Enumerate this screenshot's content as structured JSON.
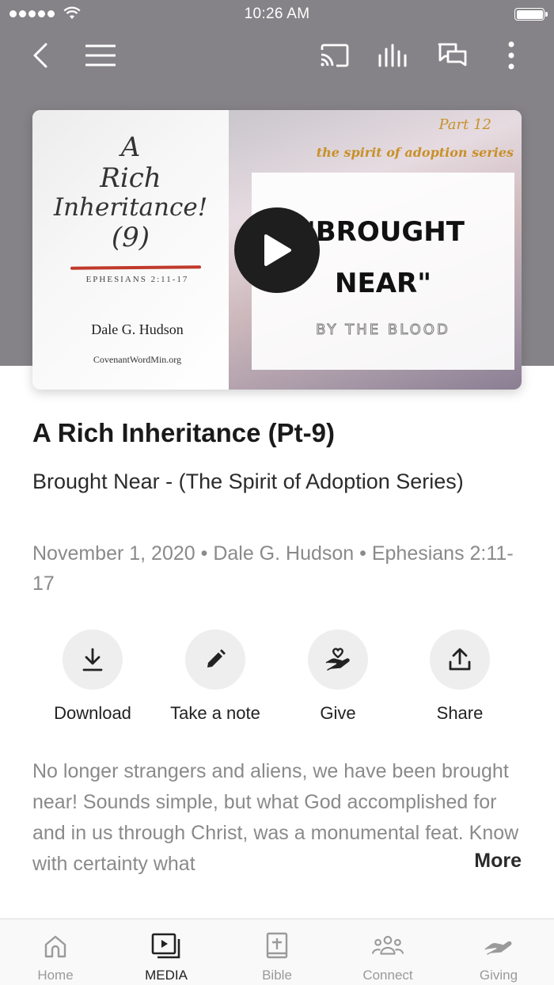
{
  "status_bar": {
    "time": "10:26 AM"
  },
  "hero": {
    "book": {
      "title_line1": "A",
      "title_line2": "Rich",
      "title_line3": "Inheritance!",
      "title_line4": "(9)",
      "reference": "EPHESIANS 2:11-17",
      "author": "Dale G. Hudson",
      "website": "CovenantWordMin.org"
    },
    "part": "Part 12",
    "series": "the spirit of adoption series",
    "quote_line1": "\"BROUGHT",
    "quote_line2": "NEAR\"",
    "quote_sub": "BY THE BLOOD"
  },
  "sermon": {
    "title": "A Rich Inheritance (Pt-9)",
    "subtitle": "Brought Near - (The Spirit of Adoption Series)",
    "meta": "November 1, 2020 • Dale G. Hudson • Ephesians 2:11-17",
    "description": "No longer strangers and aliens, we have been brought near! Sounds simple, but what God accomplished for and in us through Christ, was a monumental feat.  Know with certainty what",
    "more_label": "More"
  },
  "actions": [
    {
      "label": "Download",
      "icon": "download-icon"
    },
    {
      "label": "Take a note",
      "icon": "pencil-icon"
    },
    {
      "label": "Give",
      "icon": "giving-hand-icon"
    },
    {
      "label": "Share",
      "icon": "share-icon"
    }
  ],
  "tabs": [
    {
      "label": "Home",
      "icon": "home-icon"
    },
    {
      "label": "MEDIA",
      "icon": "media-icon",
      "active": true
    },
    {
      "label": "Bible",
      "icon": "bible-icon"
    },
    {
      "label": "Connect",
      "icon": "people-icon"
    },
    {
      "label": "Giving",
      "icon": "giving-icon"
    }
  ],
  "colors": {
    "header_bg": "#858387",
    "accent_gold": "#c8902a",
    "text_muted": "#8a8a8a",
    "action_circle": "#eeeeee"
  }
}
